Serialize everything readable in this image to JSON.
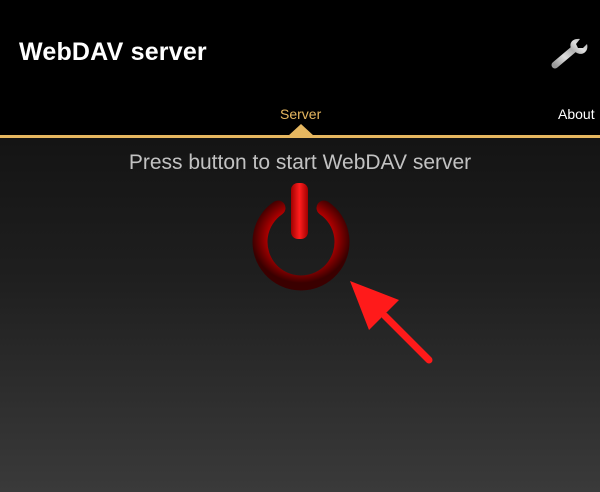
{
  "app": {
    "title": "WebDAV server"
  },
  "toolbar": {
    "settings_icon": "wrench-icon"
  },
  "tabs": [
    {
      "label": "Server",
      "selected": true
    },
    {
      "label": "About",
      "selected": false
    }
  ],
  "colors": {
    "accent": "#e6b760",
    "power_button": "#c00000",
    "annotation_arrow": "#ff1a1a"
  },
  "main": {
    "prompt": "Press button to start WebDAV server",
    "power_button_icon": "power-icon",
    "annotation_icon": "red-arrow-icon"
  }
}
